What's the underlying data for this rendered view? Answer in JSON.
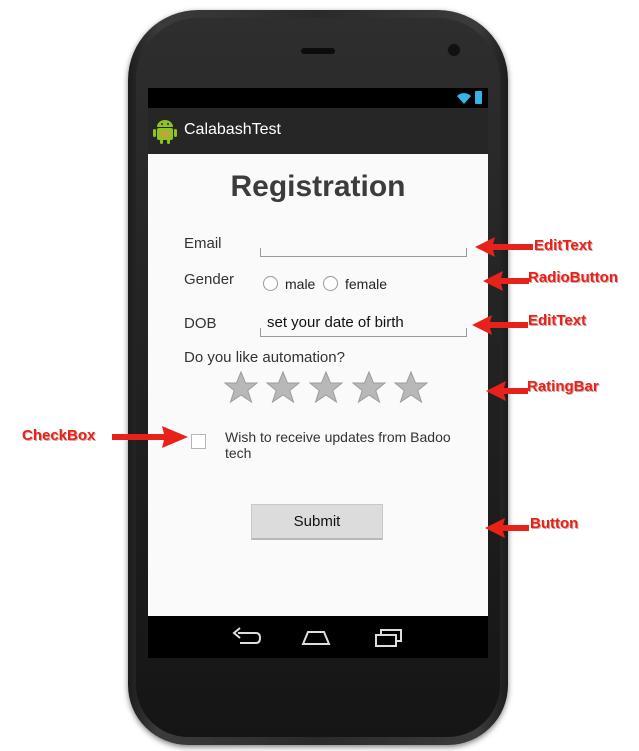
{
  "statusbar": {
    "icons": [
      "wifi-icon",
      "battery-icon"
    ]
  },
  "actionbar": {
    "title": "CalabashTest",
    "icon": "android-app-icon"
  },
  "form": {
    "heading": "Registration",
    "email_label": "Email",
    "email_value": "",
    "gender_label": "Gender",
    "gender_options": [
      "male",
      "female"
    ],
    "dob_label": "DOB",
    "dob_value": "set your date of birth",
    "automation_question": "Do you like automation?",
    "rating": 0,
    "rating_max": 5,
    "checkbox_label": "Wish to receive updates from Badoo tech",
    "checkbox_checked": false,
    "submit_label": "Submit"
  },
  "navbar": {
    "icons": [
      "back-icon",
      "home-icon",
      "recents-icon"
    ]
  },
  "annotations": {
    "edittext_1": "EditText",
    "radiobutton": "RadioButton",
    "edittext_2": "EditText",
    "ratingbar": "RatingBar",
    "checkbox": "CheckBox",
    "button": "Button"
  },
  "colors": {
    "annotation": "#e8221a",
    "accent": "#33b5e5",
    "actionbar": "#262626"
  }
}
